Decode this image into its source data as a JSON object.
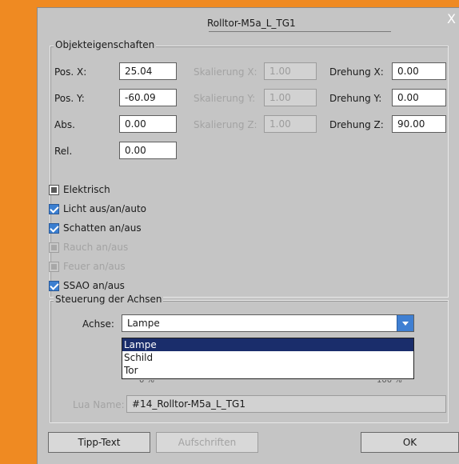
{
  "window": {
    "title": "Rolltor-M5a_L_TG1",
    "close_label": "X"
  },
  "objekt": {
    "legend": "Objekteigenschaften",
    "pos_x_label": "Pos. X:",
    "pos_x": "25.04",
    "pos_y_label": "Pos. Y:",
    "pos_y": "-60.09",
    "abs_label": "Abs.",
    "abs": "0.00",
    "rel_label": "Rel.",
    "rel": "0.00",
    "skal_x_label": "Skalierung X:",
    "skal_x": "1.00",
    "skal_y_label": "Skalierung Y:",
    "skal_y": "1.00",
    "skal_z_label": "Skalierung Z:",
    "skal_z": "1.00",
    "dreh_x_label": "Drehung X:",
    "dreh_x": "0.00",
    "dreh_y_label": "Drehung Y:",
    "dreh_y": "0.00",
    "dreh_z_label": "Drehung Z:",
    "dreh_z": "90.00"
  },
  "checkboxes": [
    {
      "label": "Elektrisch",
      "state": "indeterminate",
      "enabled": true
    },
    {
      "label": "Licht aus/an/auto",
      "state": "checked",
      "enabled": true
    },
    {
      "label": "Schatten an/aus",
      "state": "checked",
      "enabled": true
    },
    {
      "label": "Rauch an/aus",
      "state": "indeterminate",
      "enabled": false
    },
    {
      "label": "Feuer an/aus",
      "state": "indeterminate",
      "enabled": false
    },
    {
      "label": "SSAO an/aus",
      "state": "checked",
      "enabled": true
    }
  ],
  "achsen": {
    "legend": "Steuerung der Achsen",
    "achse_label": "Achse:",
    "selected": "Lampe",
    "options": [
      "Lampe",
      "Schild",
      "Tor"
    ],
    "slider_min": "0 %",
    "slider_max": "100 %"
  },
  "lua": {
    "label": "Lua Name:",
    "value": "#14_Rolltor-M5a_L_TG1"
  },
  "buttons": {
    "tipp": "Tipp-Text",
    "aufschriften": "Aufschriften",
    "ok": "OK"
  },
  "colors": {
    "background": "#ef8a22",
    "dialog": "#c5c5c5",
    "selection": "#1a2d6b",
    "accent": "#3b7fd1"
  }
}
